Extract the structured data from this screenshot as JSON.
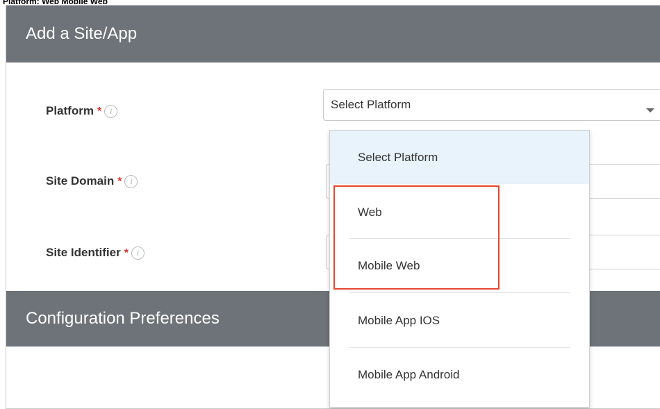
{
  "caption": "Platform: Web Mobile Web",
  "add_site": {
    "title": "Add a Site/App",
    "fields": [
      {
        "label": "Platform",
        "required": "*",
        "info_icon": "info-icon"
      },
      {
        "label": "Site Domain",
        "required": "*",
        "info_icon": "info-icon"
      },
      {
        "label": "Site Identifier",
        "required": "*",
        "info_icon": "info-icon"
      }
    ],
    "platform_select": {
      "value": "Select Platform"
    }
  },
  "dropdown": {
    "options": [
      "Select Platform",
      "Web",
      "Mobile Web",
      "Mobile App IOS",
      "Mobile App Android"
    ],
    "highlighted": "Select Platform"
  },
  "config": {
    "title": "Configuration Preferences"
  },
  "colors": {
    "header_bg": "#6d7378",
    "required": "#e0342a",
    "highlight_box": "#e5462d",
    "option_hover": "#e8f3fb"
  }
}
